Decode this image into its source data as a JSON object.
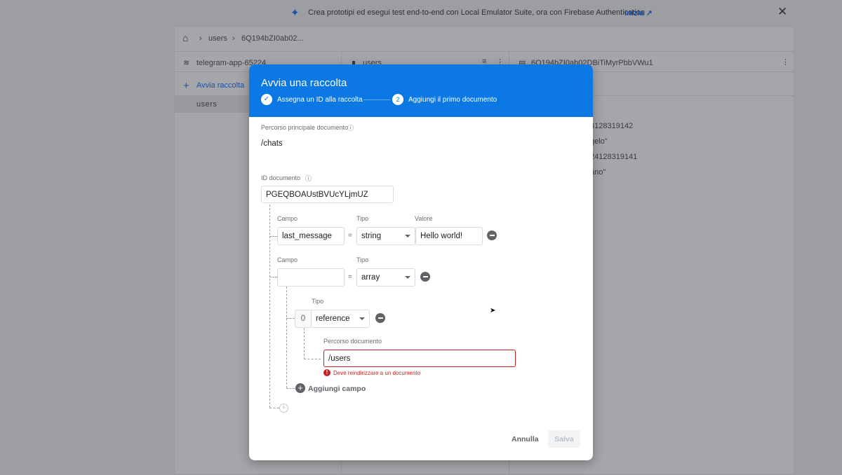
{
  "banner": {
    "text": "Crea prototipi ed esegui test end-to-end con Local Emulator Suite, ora con Firebase Authentication",
    "link": "Inizia",
    "icon": "sparkle-icon"
  },
  "breadcrumb": {
    "items": [
      "users",
      "6Q194bZI0ab02..."
    ]
  },
  "columns": {
    "project": "telegram-app-65224",
    "add_collection": "Avvia raccolta",
    "collections": [
      "users"
    ],
    "collection": "users",
    "document": "6Q194bZI0ab02DBiTiMyrPbbVWu1",
    "fields": [
      "4128319142",
      "gelo\"",
      "24128319141",
      "ano\""
    ]
  },
  "dialog": {
    "title": "Avvia una raccolta",
    "steps": [
      {
        "label": "Assegna un ID alla raccolta",
        "done": true
      },
      {
        "number": "2",
        "label": "Aggiungi il primo documento"
      }
    ],
    "parent_path_label": "Percorso principale documento",
    "parent_path": "/chats",
    "doc_id_label": "ID documento",
    "doc_id": "PGEQBOAUstBVUcYLjmUZ",
    "field_label": "Campo",
    "type_label": "Tipo",
    "value_label": "Valore",
    "fields": [
      {
        "name": "last_message",
        "type": "string",
        "value": "Hello world!"
      },
      {
        "name": "",
        "type": "array"
      }
    ],
    "array_item": {
      "index": "0",
      "type": "reference",
      "path_label": "Percorso documento",
      "path": "/users",
      "error": "Deve reindirizzare a un documento"
    },
    "add_field": "Aggiungi campo",
    "cancel": "Annulla",
    "save": "Salva",
    "accent": "#0b78e3",
    "error_color": "#c5221f"
  }
}
